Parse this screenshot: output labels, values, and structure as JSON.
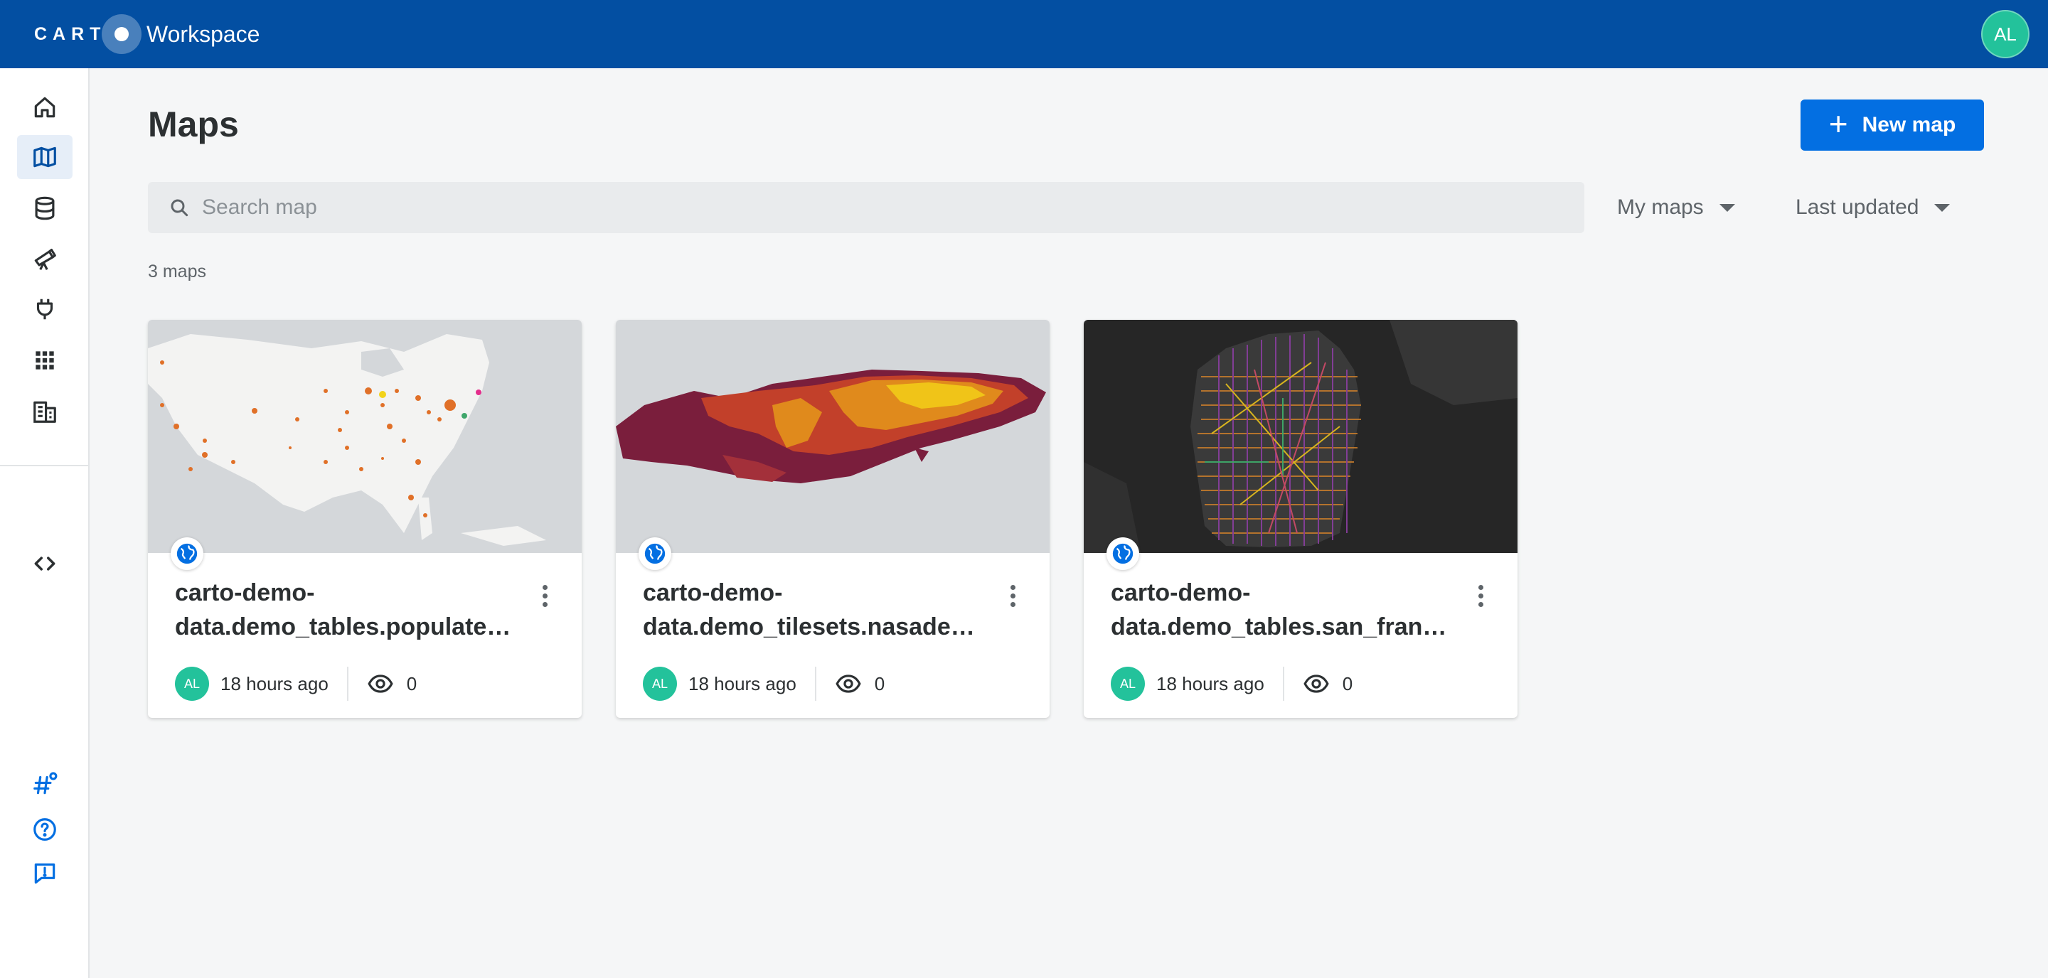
{
  "header": {
    "logo_text": "CARTO",
    "app_name": "Workspace",
    "user_initials": "AL",
    "brand_color": "#034fa2"
  },
  "sidebar": {
    "items": [
      {
        "name": "home",
        "icon": "home-icon",
        "active": false
      },
      {
        "name": "maps",
        "icon": "map-icon",
        "active": true
      },
      {
        "name": "data",
        "icon": "database-icon",
        "active": false
      },
      {
        "name": "data-observatory",
        "icon": "telescope-icon",
        "active": false
      },
      {
        "name": "connections",
        "icon": "plug-icon",
        "active": false
      },
      {
        "name": "applications",
        "icon": "grid-icon",
        "active": false
      },
      {
        "name": "organization",
        "icon": "building-icon",
        "active": false
      },
      {
        "name": "developers",
        "icon": "code-icon",
        "active": false
      }
    ],
    "bottom": [
      {
        "name": "whats-new",
        "icon": "hashtag-icon"
      },
      {
        "name": "help",
        "icon": "help-icon"
      },
      {
        "name": "feedback",
        "icon": "feedback-icon"
      }
    ]
  },
  "main": {
    "title": "Maps",
    "new_map_label": "New map",
    "search_placeholder": "Search map",
    "filter_owner": "My maps",
    "sort_by": "Last updated",
    "count_label": "3 maps",
    "accent_color": "#036fe2"
  },
  "maps": [
    {
      "title_line1": "carto-demo-",
      "title_line2": "data.demo_tables.populated_places",
      "owner_initials": "AL",
      "updated": "18 hours ago",
      "views": "0",
      "public": true
    },
    {
      "title_line1": "carto-demo-",
      "title_line2": "data.demo_tilesets.nasadem_tileset",
      "owner_initials": "AL",
      "updated": "18 hours ago",
      "views": "0",
      "public": true
    },
    {
      "title_line1": "carto-demo-",
      "title_line2": "data.demo_tables.san_francisco_street_trees",
      "owner_initials": "AL",
      "updated": "18 hours ago",
      "views": "0",
      "public": true
    }
  ]
}
